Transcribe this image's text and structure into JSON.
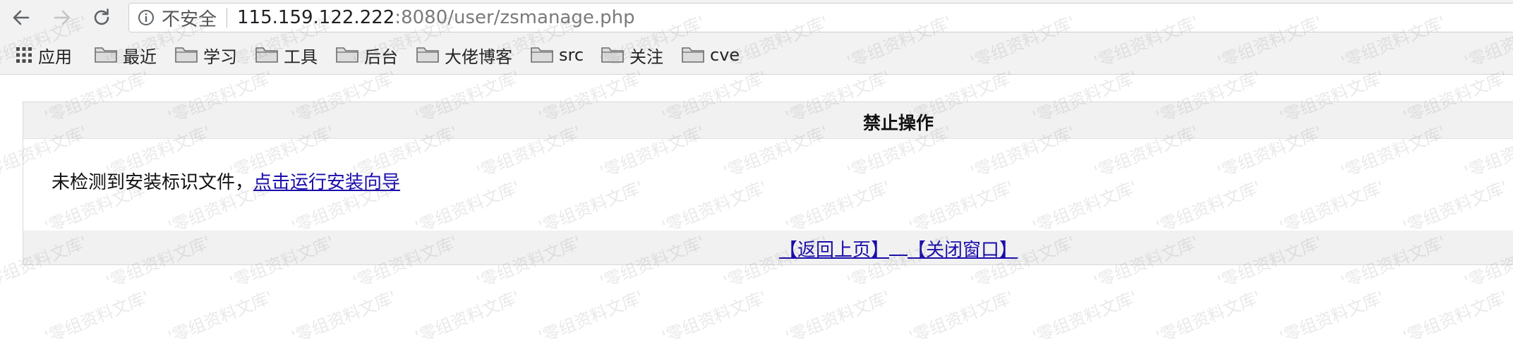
{
  "browser": {
    "security_label": "不安全",
    "url_host": "115.159.122.222",
    "url_rest": ":8080/user/zsmanage.php",
    "icons": {
      "back": "back-arrow-icon",
      "forward": "forward-arrow-icon",
      "reload": "reload-icon",
      "info": "info-circle-icon",
      "apps": "apps-grid-icon",
      "folder": "folder-icon"
    }
  },
  "bookmarks": [
    {
      "label": "应用"
    },
    {
      "label": "最近"
    },
    {
      "label": "学习"
    },
    {
      "label": "工具"
    },
    {
      "label": "后台"
    },
    {
      "label": "大佬博客"
    },
    {
      "label": "src"
    },
    {
      "label": "关注"
    },
    {
      "label": "cve"
    }
  ],
  "page": {
    "title": "禁止操作",
    "message": "未检测到安装标识文件，",
    "install_link": "点击运行安装向导",
    "back_link": "【返回上页】",
    "close_link": "【关闭窗口】"
  },
  "watermark": {
    "text": "'零组资料文库'"
  },
  "colors": {
    "chrome_bg": "#f2f2f2",
    "panel_header_bg": "#f1f1f1",
    "link": "#1a0dab"
  }
}
